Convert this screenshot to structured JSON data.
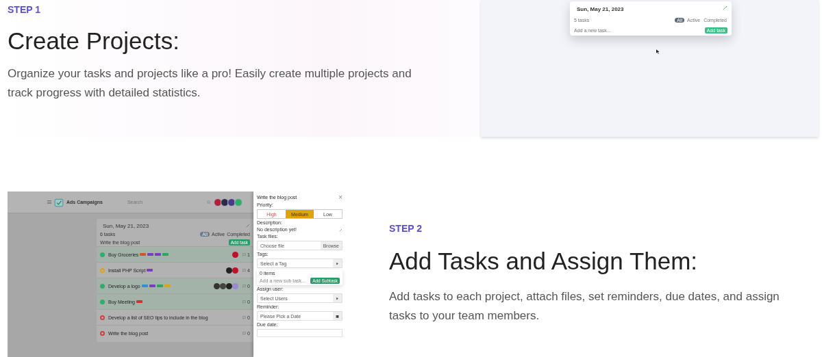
{
  "step1": {
    "step": "STEP 1",
    "title": "Create Projects:",
    "description": "Organize your tasks and projects like a pro! Easily create multiple projects and track progress with detailed statistics."
  },
  "demo1": {
    "date": "Sun, May 21, 2023",
    "count": "5 tasks",
    "filters": [
      {
        "label": "All",
        "selected": true
      },
      {
        "label": "Active",
        "selected": false
      },
      {
        "label": "Completed",
        "selected": false
      }
    ],
    "placeholder": "Add a new task...",
    "button": "Add task"
  },
  "demo2": {
    "project": "Ads Campaigns",
    "search_placeholder": "Search",
    "header_avatars": [
      {
        "color": "#b0203a"
      },
      {
        "color": "#2a2a4a"
      },
      {
        "color": "#4a3a8a"
      },
      {
        "color": "#2fae6a"
      }
    ],
    "card": {
      "date": "Sun, May 21, 2023",
      "count": "6 tasks",
      "filters": [
        {
          "label": "All",
          "selected": true
        },
        {
          "label": "Active",
          "selected": false
        },
        {
          "label": "Completed",
          "selected": false
        }
      ],
      "input": "Write the blog post",
      "button": "Add task",
      "tasks": [
        {
          "title": "Buy Groceries",
          "done": true,
          "color": "#2fae6a",
          "tags": [
            {
              "color": "#d2542a"
            },
            {
              "color": "#7a3fc0"
            },
            {
              "color": "#7a3fc0"
            },
            {
              "color": "#27a85a"
            }
          ],
          "avatars": [
            {
              "color": "#c0102a"
            }
          ],
          "comments": "1"
        },
        {
          "title": "Install PHP Script",
          "done": false,
          "color": "#e0a020",
          "tags": [
            {
              "color": "#7a3fc0"
            }
          ],
          "avatars": [
            {
              "color": "#222222"
            },
            {
              "color": "#c0102a"
            }
          ],
          "comments": "4"
        },
        {
          "title": "Develop a logo",
          "done": true,
          "color": "#2fae6a",
          "tags": [
            {
              "color": "#2f8fd8"
            },
            {
              "color": "#7a3fc0"
            },
            {
              "color": "#27a85a"
            },
            {
              "color": "#e0a020"
            }
          ],
          "avatars": [
            {
              "color": "#333333"
            },
            {
              "color": "#444444"
            },
            {
              "color": "#222222"
            },
            {
              "color": "#9a8ad0"
            }
          ],
          "comments": "0"
        },
        {
          "title": "Buy Meeting",
          "done": true,
          "color": "#2fae6a",
          "tags": [
            {
              "color": "#d2342a"
            }
          ],
          "comments": "0"
        },
        {
          "title": "Develop a list of SEO tips to include in the blog",
          "done": false,
          "color": "#d04040",
          "comments": "0"
        },
        {
          "title": "Write the blog post",
          "done": false,
          "color": "#d04040",
          "comments": "0"
        }
      ]
    },
    "drawer": {
      "title": "Write the blog post",
      "close": "×",
      "priority_label": "Priority:",
      "priorities": [
        {
          "label": "High",
          "selected": false
        },
        {
          "label": "Medium",
          "selected": true
        },
        {
          "label": "Low",
          "selected": false
        }
      ],
      "description_label": "Description:",
      "description": "No description yet!",
      "files_label": "Task files:",
      "file_placeholder": "Choose file",
      "browse": "Browse",
      "tags_label": "Tags:",
      "tags_placeholder": "Select a Tag",
      "subtasks_count": "0 items",
      "subtask_placeholder": "Add a new sub task...",
      "subtask_button": "Add Subtask",
      "assign_label": "Assign user:",
      "assign_placeholder": "Select Users",
      "reminder_label": "Reminder:",
      "reminder_placeholder": "Please Pick a Date",
      "due_label": "Due date:"
    }
  },
  "step2": {
    "step": "STEP 2",
    "title": "Add Tasks and Assign Them:",
    "description": "Add tasks to each project, attach files, set reminders, due dates, and assign tasks to your team members."
  }
}
